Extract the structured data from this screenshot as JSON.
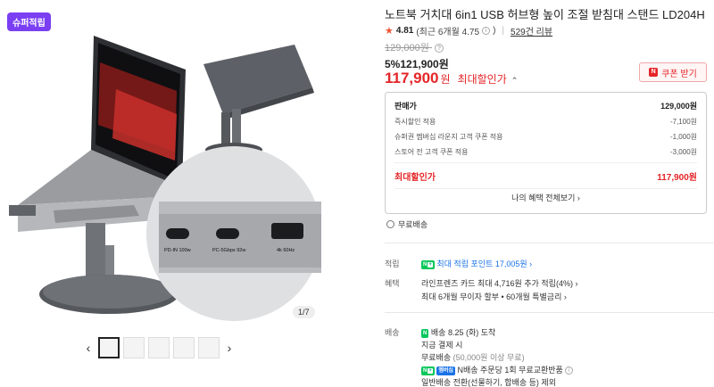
{
  "gallery": {
    "badge": "슈퍼적립",
    "counter": "1/7",
    "main_image_desc": "laptop-stand-with-usb-hub",
    "prev_icon": "chevron-left-icon",
    "next_icon": "chevron-right-icon",
    "port_labels": {
      "pd_in": "PD-IN 100w",
      "pc": "PC-5Gbps 92w",
      "hdmi": "4k 60Hz"
    }
  },
  "product": {
    "title": "노트북 거치대 6in1 USB 허브형 높이 조절 받침대 스탠드 LD204H",
    "rating": "4.81",
    "rating_recent": "(최근 6개월 4.75",
    "reviews": "529건 리뷰",
    "original_price": "129,000원",
    "discount": "5%121,900원",
    "final_price": "117,900",
    "final_won": "원",
    "final_label": "최대할인가",
    "coupon": "쿠폰 받기"
  },
  "price_box": {
    "rows": [
      {
        "label": "판매가",
        "value": "129,000원"
      },
      {
        "label": "즉시할인 적용",
        "value": "-7,100원"
      },
      {
        "label": "슈퍼권 멤버십 라운지 고객 쿠폰 적용",
        "value": "-1,000원"
      },
      {
        "label": "스토어 전 고객 쿠폰 적용",
        "value": "-3,000원"
      }
    ],
    "total_label": "최대할인가",
    "total_value": "117,900원",
    "all_benefits": "나의 혜택 전체보기 ›"
  },
  "shipping_free": "무료배송",
  "points": {
    "label": "적립",
    "text": "최대 적립 포인트 17,005원 ›"
  },
  "benefits": {
    "label": "혜택",
    "line1": "라인프렌즈 카드 최대 4,716원 추가 적립(4%) ›",
    "line2": "최대 6개월 무이자 할부 • 60개월 특별금리 ›"
  },
  "delivery": {
    "label": "배송",
    "line1_tag": "배송",
    "line1": "8.25 (화) 도착",
    "line2": "지금 결제 시",
    "line3": "무료배송",
    "line3_sub": "(50,000원 이상 무료)",
    "line4_tag": "멤버십",
    "line4": "N배송 주문당 1회 무료교환반품",
    "line5": "일반배송 전환(선물하기, 합배송 등) 제외"
  },
  "colors": {
    "accent_red": "#e52528",
    "naver_green": "#03c75a",
    "badge_purple": "#7a3ff2"
  }
}
